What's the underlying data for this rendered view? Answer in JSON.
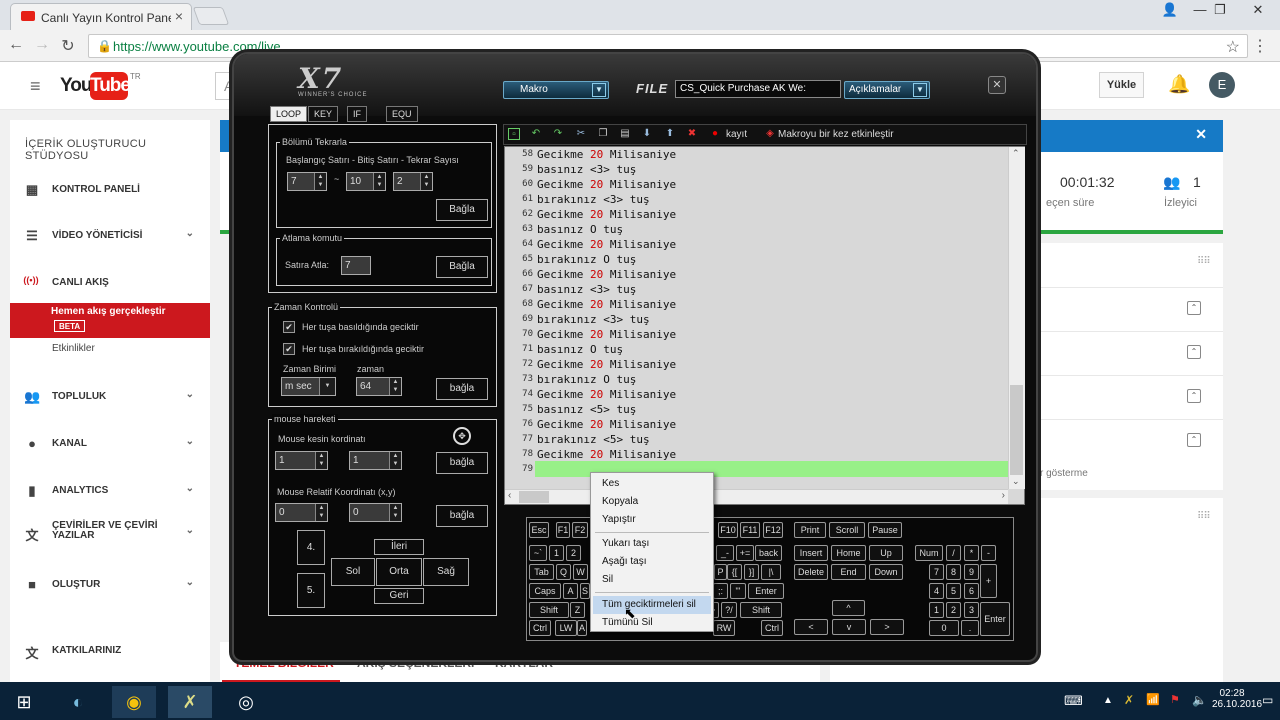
{
  "browser": {
    "tab_title": "Canlı Yayın Kontrol Paneli",
    "url": "https://www.youtube.com/live",
    "star": "☆",
    "menu": "⋮"
  },
  "youtube": {
    "region": "TR",
    "search_placeholder": "Ara",
    "upload": "Yükle",
    "avatar": "E",
    "sidebar_title": "İÇERİK OLUŞTURUCU STÜDYOSU",
    "sidebar": [
      {
        "label": "KONTROL PANELİ",
        "icon": "dashboard-icon",
        "glyph": "▦",
        "chevron": ""
      },
      {
        "label": "VİDEO YÖNETİCİSİ",
        "icon": "video-manager-icon",
        "glyph": "☰",
        "chevron": "⌄"
      },
      {
        "label": "CANLI AKIŞ",
        "icon": "live-icon",
        "glyph": "((•))",
        "chevron": ""
      },
      {
        "label": "TOPLULUK",
        "icon": "community-icon",
        "glyph": "👥",
        "chevron": "⌄"
      },
      {
        "label": "KANAL",
        "icon": "channel-icon",
        "glyph": "●",
        "chevron": "⌄"
      },
      {
        "label": "ANALYTICS",
        "icon": "analytics-icon",
        "glyph": "▮",
        "chevron": "⌄"
      },
      {
        "label": "ÇEVİRİLER VE ÇEVİRİ YAZILAR",
        "icon": "translate-icon",
        "glyph": "文",
        "chevron": "⌄"
      },
      {
        "label": "OLUŞTUR",
        "icon": "create-icon",
        "glyph": "■",
        "chevron": "⌄"
      },
      {
        "label": "KATKILARINIZ",
        "icon": "contributions-icon",
        "glyph": "文",
        "chevron": ""
      }
    ],
    "active_item": "Hemen akış gerçekleştir",
    "beta": "BETA",
    "sub_item": "Etkinlikler",
    "duration": "00:01:32",
    "duration_label": "eçen süre",
    "viewers": "1",
    "viewers_label": "İzleyici",
    "show_label": "r gösterme",
    "tabs": [
      "TEMEL BİLGİLER",
      "AKIŞ SEÇENEKLERİ",
      "KARTLAR"
    ]
  },
  "x7": {
    "logo": "X7",
    "logo_sub": "WINNER'S CHOICE",
    "macro_dropdown": "Makro",
    "file_label": "FILE",
    "file_name": "CS_Quick Purchase AK We:",
    "desc_dropdown": "Açıklamalar",
    "tabs": [
      "LOOP",
      "KEY",
      "IF",
      "EQU"
    ],
    "repeat": {
      "title": "Bölümü Tekrarla",
      "label": "Başlangıç Satırı - Bitiş Satırı - Tekrar Sayısı",
      "start": "7",
      "end": "10",
      "count": "2",
      "tilde": "~",
      "button": "Bağla"
    },
    "jump": {
      "title": "Atlama komutu",
      "label": "Satıra Atla:",
      "value": "7",
      "button": "Bağla"
    },
    "time": {
      "title": "Zaman Kontrolü",
      "opt1": "Her tuşa basıldığında geciktir",
      "opt2": "Her tuşa bırakıldığında geciktir",
      "unit_label": "Zaman Birimi",
      "unit": "m sec",
      "val_label": "zaman",
      "value": "64",
      "button": "bağla"
    },
    "mouse": {
      "title": "mouse hareketi",
      "abs_label": "Mouse kesin kordinatı",
      "abs_x": "1",
      "abs_y": "1",
      "rel_label": "Mouse Relatif Koordinatı (x,y)",
      "rel_x": "0",
      "rel_y": "0",
      "button": "bağla",
      "b4": "4.",
      "b5": "5.",
      "fwd": "İleri",
      "left": "Sol",
      "mid": "Orta",
      "right": "Sağ",
      "back": "Geri"
    },
    "toolbar": {
      "record": "kayıt",
      "once": "Makroyu bir kez etkinleştir"
    },
    "lines": [
      {
        "n": "58",
        "a": "Gecikme ",
        "d": "20",
        "b": " Milisaniye"
      },
      {
        "n": "59",
        "a": "basınız <3> tuş",
        "d": "",
        "b": ""
      },
      {
        "n": "60",
        "a": "Gecikme ",
        "d": "20",
        "b": " Milisaniye"
      },
      {
        "n": "61",
        "a": "bırakınız <3> tuş",
        "d": "",
        "b": ""
      },
      {
        "n": "62",
        "a": "Gecikme ",
        "d": "20",
        "b": " Milisaniye"
      },
      {
        "n": "63",
        "a": "basınız O tuş",
        "d": "",
        "b": ""
      },
      {
        "n": "64",
        "a": "Gecikme ",
        "d": "20",
        "b": " Milisaniye"
      },
      {
        "n": "65",
        "a": "bırakınız O tuş",
        "d": "",
        "b": ""
      },
      {
        "n": "66",
        "a": "Gecikme ",
        "d": "20",
        "b": " Milisaniye"
      },
      {
        "n": "67",
        "a": "basınız <3> tuş",
        "d": "",
        "b": ""
      },
      {
        "n": "68",
        "a": "Gecikme ",
        "d": "20",
        "b": " Milisaniye"
      },
      {
        "n": "69",
        "a": "bırakınız <3> tuş",
        "d": "",
        "b": ""
      },
      {
        "n": "70",
        "a": "Gecikme ",
        "d": "20",
        "b": " Milisaniye"
      },
      {
        "n": "71",
        "a": "basınız O tuş",
        "d": "",
        "b": ""
      },
      {
        "n": "72",
        "a": "Gecikme ",
        "d": "20",
        "b": " Milisaniye"
      },
      {
        "n": "73",
        "a": "bırakınız O tuş",
        "d": "",
        "b": ""
      },
      {
        "n": "74",
        "a": "Gecikme ",
        "d": "20",
        "b": " Milisaniye"
      },
      {
        "n": "75",
        "a": "basınız <5> tuş",
        "d": "",
        "b": ""
      },
      {
        "n": "76",
        "a": "Gecikme ",
        "d": "20",
        "b": " Milisaniye"
      },
      {
        "n": "77",
        "a": "bırakınız <5> tuş",
        "d": "",
        "b": ""
      },
      {
        "n": "78",
        "a": "Gecikme ",
        "d": "20",
        "b": " Milisaniye"
      },
      {
        "n": "79",
        "a": "",
        "d": "",
        "b": ""
      }
    ],
    "context_menu": [
      "Kes",
      "Kopyala",
      "Yapıştır",
      "Yukarı taşı",
      "Aşağı taşı",
      "Sil",
      "Tüm geciktirmeleri sil",
      "Tümünü Sil"
    ]
  },
  "keys": {
    "r1": [
      "Esc",
      "F1",
      "F2"
    ],
    "r1b": [
      "F10",
      "F11",
      "F12"
    ],
    "r1c": [
      "Print",
      "Scroll",
      "Pause"
    ],
    "r2": [
      "~`",
      "1",
      "2"
    ],
    "r2b": [
      "_-",
      "+=",
      "back"
    ],
    "r2c": [
      "Insert",
      "Home",
      "Up"
    ],
    "r2d": [
      "Num",
      "/",
      "*",
      "-"
    ],
    "r3": [
      "Tab",
      "Q",
      "W"
    ],
    "r3b": [
      "P",
      "{[",
      "}]",
      "|\\"
    ],
    "r3c": [
      "Delete",
      "End",
      "Down"
    ],
    "r3d": [
      "7",
      "8",
      "9",
      "+"
    ],
    "r4": [
      "Caps",
      "A",
      "S"
    ],
    "r4b": [
      ";:",
      "\"'",
      "Enter"
    ],
    "r4d": [
      "4",
      "5",
      "6"
    ],
    "r5": [
      "Shift",
      "Z"
    ],
    "r5b": [
      ".>",
      "?/",
      "Shift"
    ],
    "r5c": [
      "^"
    ],
    "r5d": [
      "1",
      "2",
      "3",
      "Enter"
    ],
    "r6": [
      "Ctrl",
      "LW",
      "A"
    ],
    "r6b": [
      "RW",
      "Ctrl"
    ],
    "r6c": [
      "<",
      "v",
      ">"
    ],
    "r6d": [
      "0",
      "."
    ]
  },
  "taskbar": {
    "time": "02:28",
    "date": "26.10.2016"
  }
}
